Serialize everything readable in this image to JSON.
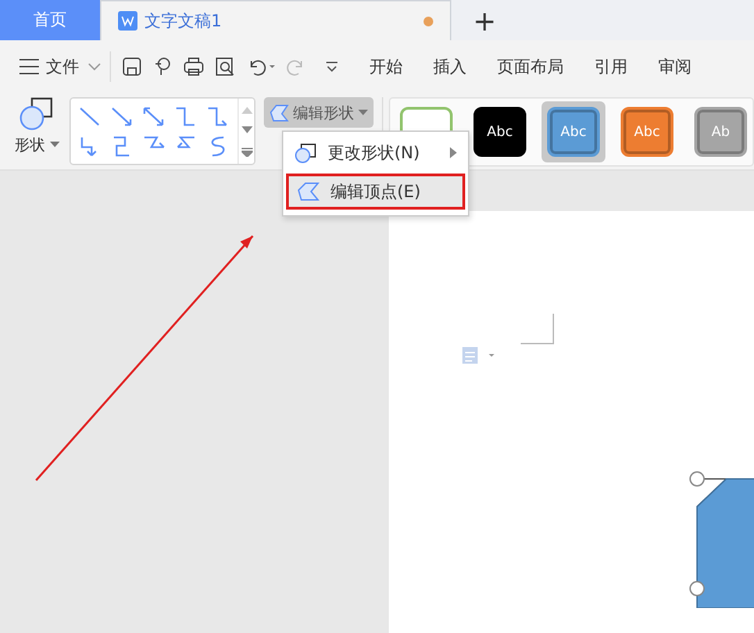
{
  "tabs": [
    {
      "kind": "home",
      "label": "首页",
      "selected": false
    },
    {
      "kind": "document",
      "label": "文字文稿1",
      "selected": true,
      "modified": true
    }
  ],
  "new_tab": "+",
  "menu": {
    "file": "文件",
    "ribbon_tabs": [
      "开始",
      "插入",
      "页面布局",
      "引用",
      "审阅"
    ]
  },
  "shape_button": "形状",
  "edit_shape_button": "编辑形状",
  "dropdown": [
    {
      "label": "更改形状(N)",
      "submenu": true,
      "highlighted": false
    },
    {
      "label": "编辑顶点(E)",
      "submenu": false,
      "highlighted": true
    }
  ],
  "styles": [
    {
      "kind": "outline",
      "color": "#92c46e",
      "selected": false
    },
    {
      "kind": "filled",
      "text": "Abc",
      "color": "#000000",
      "selected": false
    },
    {
      "kind": "filled",
      "text": "Abc",
      "color": "#5b9bd5",
      "selected": true
    },
    {
      "kind": "filled",
      "text": "Abc",
      "color": "#ed7d31",
      "selected": false
    },
    {
      "kind": "filled",
      "text": "Ab",
      "color": "#a5a5a5",
      "selected": false
    }
  ]
}
